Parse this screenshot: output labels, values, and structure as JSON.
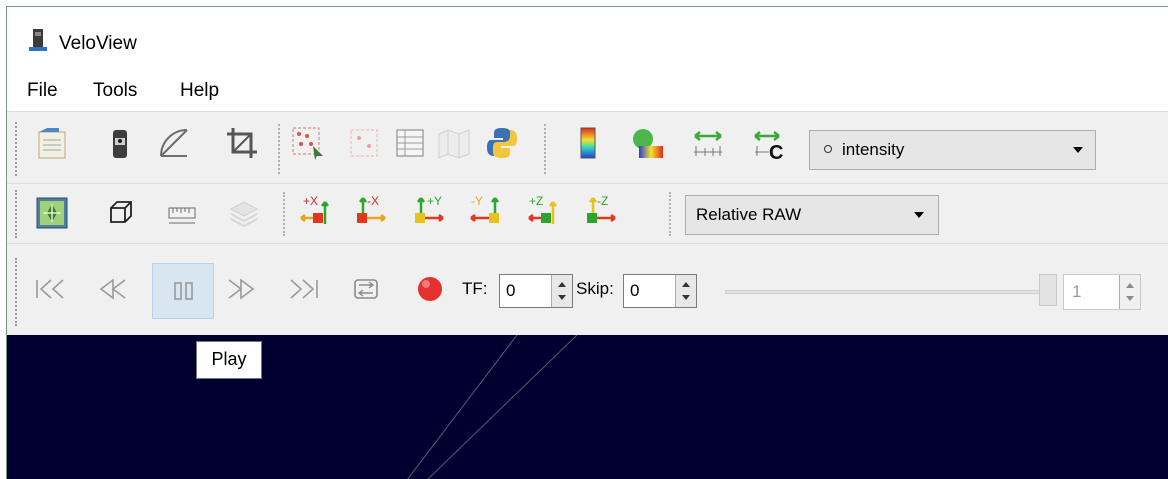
{
  "window": {
    "title": "VeloView"
  },
  "menu": [
    {
      "label": "File"
    },
    {
      "label": "Tools"
    },
    {
      "label": "Help"
    }
  ],
  "toolbar1": {
    "scalar_combo": {
      "value": "intensity",
      "icon": "point-icon"
    }
  },
  "toolbar2": {
    "mode_combo": {
      "value": "Relative RAW"
    },
    "axis_views": [
      "+X",
      "-X",
      "+Y",
      "-Y",
      "+Z",
      "-Z"
    ]
  },
  "toolbar3": {
    "tf_label": "TF:",
    "tf_value": "0",
    "skip_label": "Skip:",
    "skip_value": "0",
    "frame_value": "1",
    "slider_position": 1.0
  },
  "tooltip": {
    "text": "Play"
  },
  "colors": {
    "viewport": "#000030",
    "record": "#e53030",
    "accent_play_hover": "#d8e6f2"
  }
}
